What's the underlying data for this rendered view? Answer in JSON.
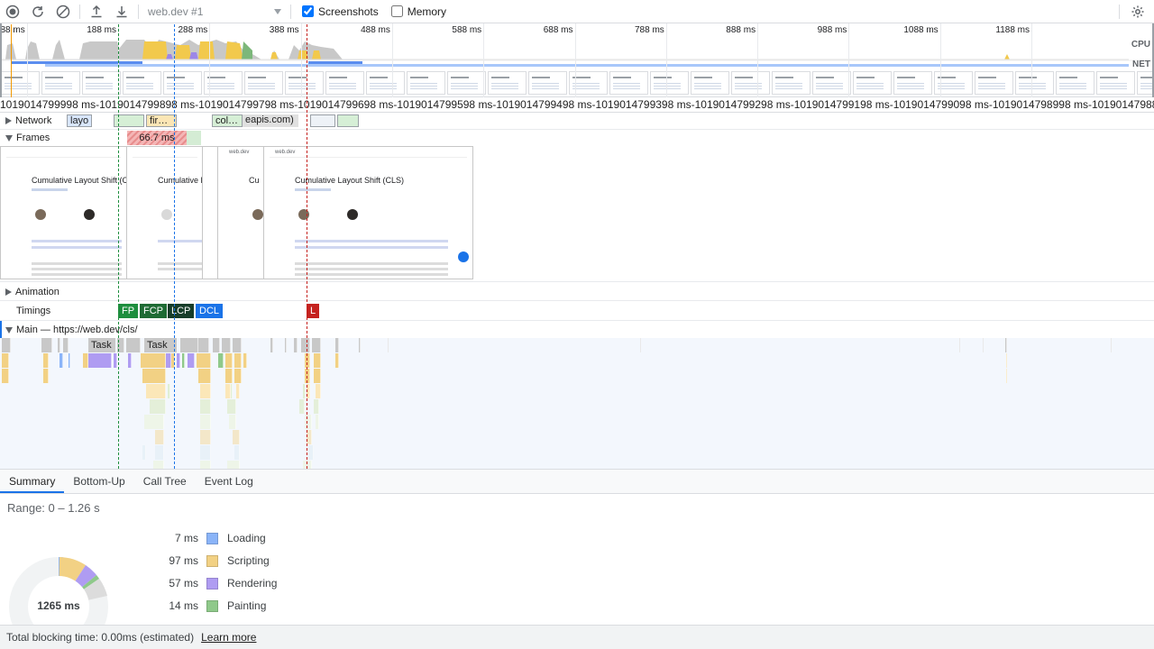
{
  "toolbar": {
    "recording_name": "web.dev #1",
    "screenshots_label": "Screenshots",
    "screenshots_checked": true,
    "memory_label": "Memory",
    "memory_checked": false,
    "icons": [
      "record-icon",
      "reload-icon",
      "clear-icon",
      "upload-icon",
      "download-icon",
      "settings-icon"
    ]
  },
  "overview": {
    "tick_labels": [
      "88 ms",
      "188 ms",
      "288 ms",
      "388 ms",
      "488 ms",
      "588 ms",
      "688 ms",
      "788 ms",
      "888 ms",
      "988 ms",
      "1088 ms",
      "1188 ms"
    ],
    "cpu_label": "CPU",
    "net_label": "NET"
  },
  "ruler": {
    "text": "1019014799998 ms-1019014799898 ms-1019014799798 ms-1019014799698 ms-1019014799598 ms-1019014799498 ms-1019014799398 ms-1019014799298 ms-1019014799198 ms-1019014799098 ms-1019014798998 ms-1019014798898 ms-101901479879"
  },
  "tracks": {
    "network": {
      "title": "Network",
      "requests": [
        "layo",
        "fir…",
        "col…",
        "eapis.com)"
      ]
    },
    "frames": {
      "title": "Frames",
      "frame_duration": "66.7 ms",
      "screenshot_title": "Cumulative Layout Shift (CLS)",
      "screenshot_title_cropped": "Cumulative Layout Shift (C",
      "screenshot_title_short": "Cumulative l",
      "screenshot_title_tiny": "Cu",
      "site_name": "web.dev"
    },
    "animation": {
      "title": "Animation"
    },
    "timings": {
      "title": "Timings",
      "markers": [
        {
          "label": "FP",
          "color": "#2e7d32"
        },
        {
          "label": "FCP",
          "color": "#1e6b34"
        },
        {
          "label": "LCP",
          "color": "#1b4332"
        },
        {
          "label": "DCL",
          "color": "#1a73e8"
        },
        {
          "label": "L",
          "color": "#c5221f"
        }
      ]
    },
    "main": {
      "title": "Main — https://web.dev/cls/",
      "task_labels": [
        "Task",
        "Task"
      ]
    }
  },
  "bottom": {
    "tabs": [
      "Summary",
      "Bottom-Up",
      "Call Tree",
      "Event Log"
    ],
    "active_tab": "Summary",
    "range": "Range: 0 – 1.26 s",
    "total": "1265 ms",
    "legend": [
      {
        "value": "7 ms",
        "label": "Loading",
        "color": "#8ab4f8"
      },
      {
        "value": "97 ms",
        "label": "Scripting",
        "color": "#f2d184"
      },
      {
        "value": "57 ms",
        "label": "Rendering",
        "color": "#af9cf2"
      },
      {
        "value": "14 ms",
        "label": "Painting",
        "color": "#8fc98a"
      }
    ],
    "footer_text": "Total blocking time: 0.00ms (estimated)",
    "learn_more": "Learn more"
  }
}
